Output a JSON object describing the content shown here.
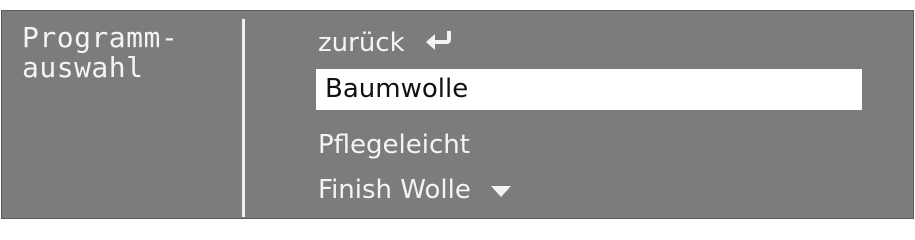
{
  "panel": {
    "title_line1": "Programm-",
    "title_line2": "auswahl"
  },
  "menu": {
    "back_label": "zurück",
    "back_icon": "return-arrow-icon",
    "items": [
      {
        "label": "Baumwolle",
        "selected": true
      },
      {
        "label": "Pflegeleicht",
        "selected": false
      },
      {
        "label": "Finish Wolle",
        "selected": false
      }
    ],
    "more_icon": "triangle-down-icon"
  },
  "colors": {
    "background": "#7c7c7c",
    "text": "#f4f4f4",
    "selected_bg": "#ffffff",
    "selected_text": "#111111"
  }
}
